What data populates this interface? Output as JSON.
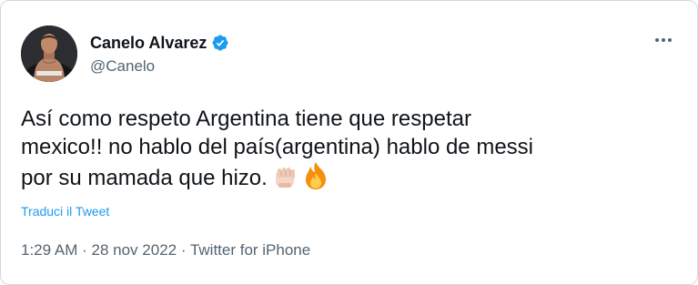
{
  "author": {
    "display_name": "Canelo Alvarez",
    "handle": "@Canelo"
  },
  "tweet": {
    "lines": [
      "Así como respeto Argentina tiene que respetar",
      "mexico!! no hablo del país(argentina) hablo de messi",
      "por su mamada que hizo."
    ],
    "translate_label": "Traduci il Tweet"
  },
  "meta": {
    "time": "1:29 AM",
    "separator": "·",
    "date": "28 nov 2022",
    "source": "Twitter for iPhone"
  },
  "colors": {
    "text": "#0f1419",
    "secondary": "#536471",
    "link": "#1d9bf0",
    "verified": "#1d9bf0",
    "border": "#cfd9de"
  },
  "icons": {
    "verified": "verified-badge-icon",
    "more": "more-options-icon",
    "emoji_1": "oncoming-fist-emoji",
    "emoji_2": "fire-emoji"
  }
}
